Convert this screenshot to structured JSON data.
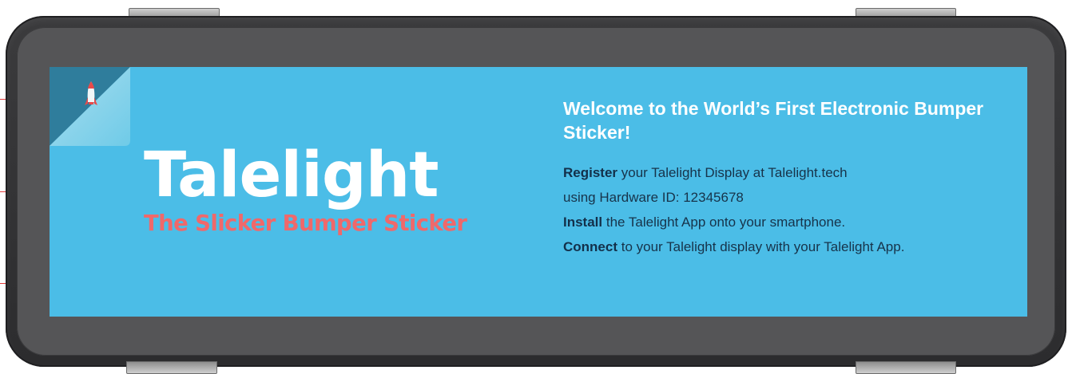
{
  "device": {
    "logo_text": "Talelight",
    "tagline": "The Slicker Bumper Sticker",
    "corner_icon": "rocket-icon",
    "colors": {
      "screen": "#4bbde7",
      "tagline": "#f0686a",
      "case": "#333335"
    }
  },
  "info": {
    "welcome": "Welcome to the World’s First Electronic Bumper Sticker!",
    "steps": [
      {
        "keyword": "Register",
        "text": " your Talelight Display at Talelight.tech"
      },
      {
        "keyword": "",
        "text": "using Hardware ID: 12345678"
      },
      {
        "keyword": "Install",
        "text": " the Talelight App onto your smartphone."
      },
      {
        "keyword": "Connect",
        "text": " to your Talelight display with your Talelight App."
      }
    ]
  }
}
